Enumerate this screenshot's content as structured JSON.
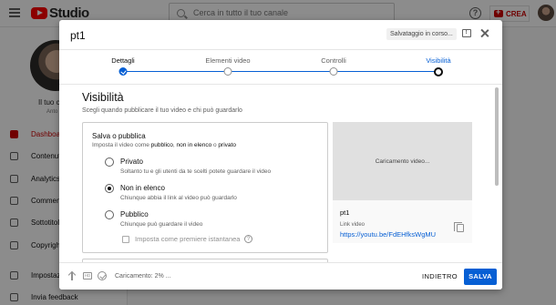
{
  "app": {
    "studio_label": "Studio",
    "search_placeholder": "Cerca in tutto il tuo canale",
    "help_glyph": "?",
    "create_label": "CREA"
  },
  "sidebar": {
    "channel_label": "Il tuo c",
    "channel_sub": "Anto",
    "items": [
      {
        "label": "Dashboar",
        "icon": "dashboard-icon",
        "active": true
      },
      {
        "label": "Contenuti",
        "icon": "content-icon"
      },
      {
        "label": "Analytics",
        "icon": "analytics-icon"
      },
      {
        "label": "Commenti",
        "icon": "comments-icon"
      },
      {
        "label": "Sottotitol",
        "icon": "subtitles-icon"
      },
      {
        "label": "Copyright",
        "icon": "copyright-icon"
      },
      {
        "label": "Impostaz",
        "icon": "settings-icon"
      },
      {
        "label": "Invia feedback",
        "icon": "feedback-icon"
      }
    ]
  },
  "dialog": {
    "title": "pt1",
    "saving_status": "Salvataggio in corso...",
    "steps": [
      {
        "label": "Dettagli",
        "state": "done"
      },
      {
        "label": "Elementi video",
        "state": "done"
      },
      {
        "label": "Controlli",
        "state": "done"
      },
      {
        "label": "Visibilità",
        "state": "current"
      }
    ],
    "section_title": "Visibilità",
    "section_desc": "Scegli quando pubblicare il tuo video e chi può guardarlo",
    "save_publish": {
      "heading": "Salva o pubblica",
      "sub_prefix": "Imposta il video come ",
      "sub_public": "pubblico",
      "sub_sep1": ", ",
      "sub_unlisted": "non in elenco",
      "sub_sep2": " o ",
      "sub_private": "privato",
      "options": [
        {
          "label": "Privato",
          "desc": "Soltanto tu e gli utenti da te scelti potete guardare il video",
          "checked": false
        },
        {
          "label": "Non in elenco",
          "desc": "Chiunque abbia il link al video può guardarlo",
          "checked": true
        },
        {
          "label": "Pubblico",
          "desc": "Chiunque può guardare il video",
          "checked": false
        }
      ],
      "premiere_label": "Imposta come premiere istantanea",
      "info_glyph": "?"
    },
    "preview": {
      "loading_text": "Caricamento video...",
      "video_title": "pt1",
      "link_label": "Link video",
      "link_url": "https://youtu.be/FdEHfksWgMU"
    },
    "footer": {
      "hd_label": "HD",
      "upload_status": "Caricamento: 2% ...",
      "back_label": "INDIETRO",
      "save_label": "SALVA"
    }
  },
  "colors": {
    "accent": "#065fd4",
    "brand_red": "#ff0000"
  }
}
